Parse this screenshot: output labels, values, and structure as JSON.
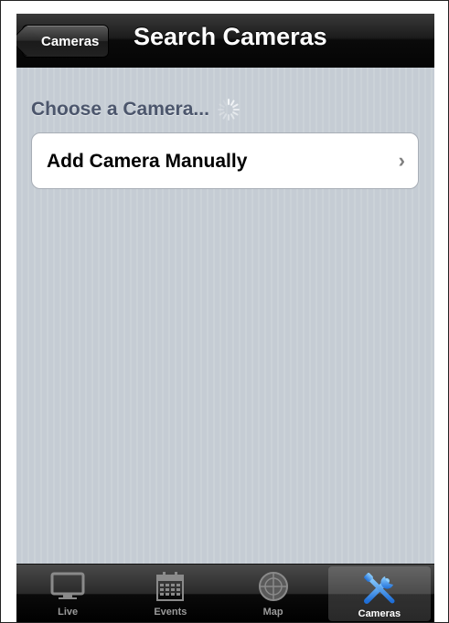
{
  "navbar": {
    "back_label": "Cameras",
    "title": "Search Cameras"
  },
  "content": {
    "section_header": "Choose a Camera...",
    "cell_label": "Add Camera Manually",
    "chevron": "›"
  },
  "tabbar": {
    "tabs": [
      {
        "label": "Live",
        "icon": "tv-icon",
        "selected": false
      },
      {
        "label": "Events",
        "icon": "calendar-icon",
        "selected": false
      },
      {
        "label": "Map",
        "icon": "radar-icon",
        "selected": false
      },
      {
        "label": "Cameras",
        "icon": "tools-icon",
        "selected": true
      }
    ]
  },
  "colors": {
    "background": "#c5ccd4",
    "header_text": "#4c566c",
    "accent_blue": "#3a8ee6"
  }
}
